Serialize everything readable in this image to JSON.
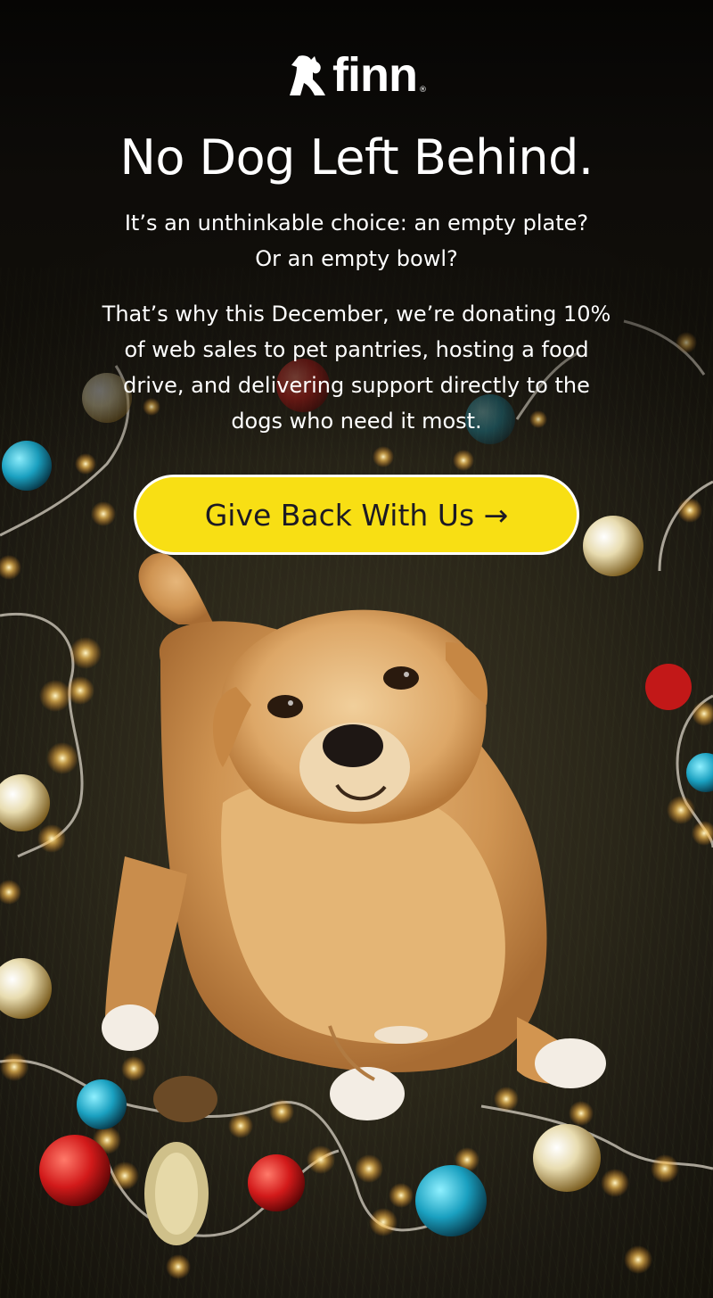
{
  "brand": {
    "logo_text": "finn",
    "registered": "®",
    "logo_icon": "dog-silhouette-icon"
  },
  "headline": "No Dog Left Behind.",
  "intro_lines": [
    "It’s an unthinkable choice: an empty plate?",
    "Or an empty bowl?"
  ],
  "body_lines": [
    "That’s why this December, we’re donating 10%",
    "of web sales to pet pantries, hosting a food",
    "drive, and delivering support directly to the",
    "dogs who need it most."
  ],
  "cta": {
    "label": "Give Back With Us →"
  },
  "colors": {
    "cta_background": "#f8df14",
    "cta_text": "#1c1a24",
    "text": "#ffffff",
    "background": "#161410"
  },
  "hero_image": {
    "subject": "dog-photo",
    "decor": [
      "ornament-icon",
      "string-lights-icon",
      "pinecone-icon"
    ]
  }
}
